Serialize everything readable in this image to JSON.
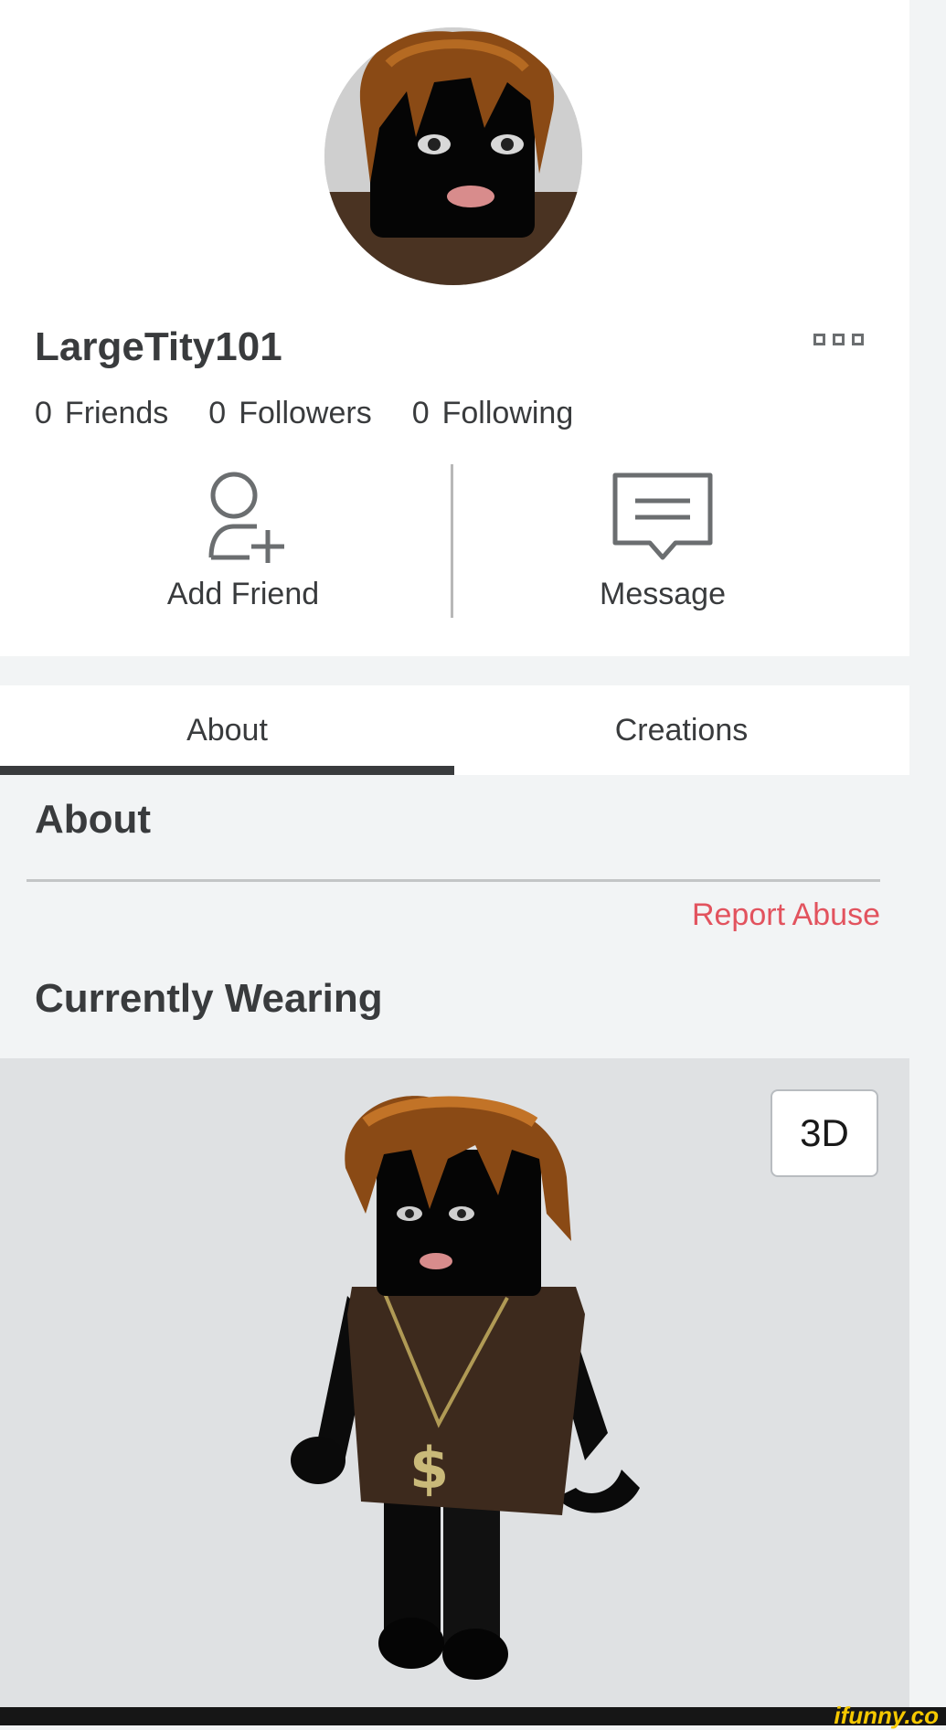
{
  "profile": {
    "username": "LargeTity101",
    "stats": [
      {
        "count": "0",
        "label": "Friends"
      },
      {
        "count": "0",
        "label": "Followers"
      },
      {
        "count": "0",
        "label": "Following"
      }
    ],
    "actions": {
      "add_friend": "Add Friend",
      "message": "Message"
    },
    "more_icon": "more-icon"
  },
  "tabs": [
    {
      "label": "About",
      "active": true
    },
    {
      "label": "Creations",
      "active": false
    }
  ],
  "about": {
    "heading": "About",
    "report_abuse": "Report Abuse"
  },
  "wearing": {
    "heading": "Currently Wearing",
    "view_toggle": "3D"
  },
  "watermark": "ifunny.co",
  "colors": {
    "accent_dark": "#393b3d",
    "report": "#e2535e",
    "panel": "#dfe1e3"
  }
}
